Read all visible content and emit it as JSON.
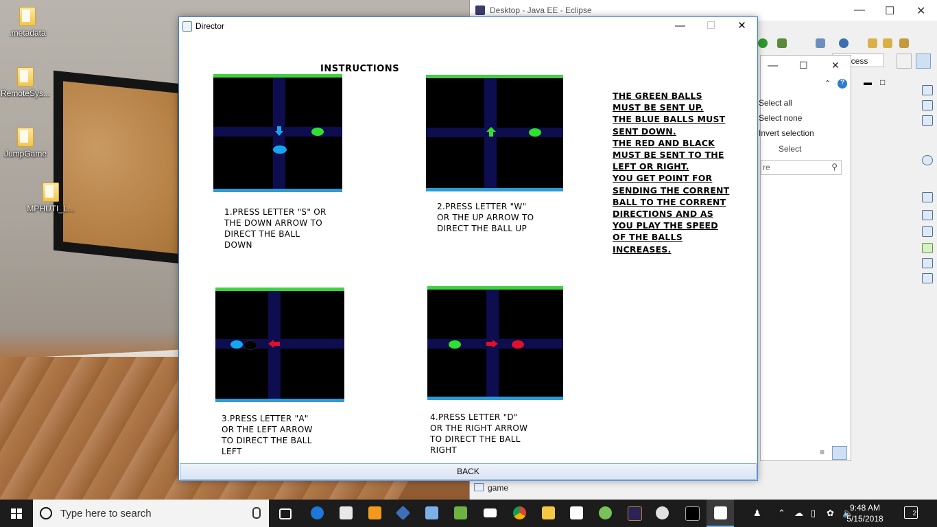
{
  "desktop": {
    "icons": [
      {
        "label": ".metadata"
      },
      {
        "label": "RemoteSys..."
      },
      {
        "label": "JumpGame"
      },
      {
        "label": "MPHUTI_L..."
      }
    ]
  },
  "eclipse": {
    "title": "Desktop - Java EE - Eclipse",
    "quick_access": "k Access",
    "side_panel": {
      "items": [
        "Select all",
        "Select none",
        "Invert selection"
      ],
      "section_label": "Select",
      "filter_value": "re"
    },
    "tree_item": "game"
  },
  "director": {
    "title": "Director",
    "heading": "INSTRUCTIONS",
    "captions": [
      [
        "1.PRESS  LETTER \"S\" OR",
        "THE DOWN ARROW TO",
        "DIRECT THE BALL",
        "DOWN"
      ],
      [
        "2.PRESS  LETTER \"W\"",
        "OR THE UP ARROW TO",
        "DIRECT THE BALL UP"
      ],
      [
        "3.PRESS  LETTER \"A\"",
        "OR THE LEFT ARROW",
        "TO DIRECT THE BALL",
        "LEFT"
      ],
      [
        "4.PRESS  LETTER \"D\"",
        "OR THE RIGHT ARROW",
        "TO DIRECT THE BALL",
        "RIGHT"
      ]
    ],
    "rules": [
      "THE GREEN BALLS",
      "MUST BE SENT UP.",
      "THE BLUE BALLS MUST",
      "SENT DOWN.",
      "THE RED AND BLACK",
      "MUST BE SENT TO THE",
      "LEFT OR RIGHT.",
      "YOU GET POINT FOR",
      "SENDING THE CORRENT",
      "BALL TO THE CORRENT",
      "DIRECTIONS AND AS",
      "YOU PLAY THE SPEED",
      "OF THE BALLS",
      "INCREASES."
    ],
    "back_label": "BACK"
  },
  "colors": {
    "green_ball": "#2ee12e",
    "blue_ball": "#14a6f0",
    "red_ball": "#e0102a",
    "black_ball": "#000000",
    "lane": "#0d0d4f",
    "top_bar": "#3ed33e",
    "bottom_bar": "#2d9bd8"
  },
  "taskbar": {
    "search_placeholder": "Type here to search",
    "time": "9:48 AM",
    "date": "5/15/2018",
    "notification_count": "2"
  }
}
